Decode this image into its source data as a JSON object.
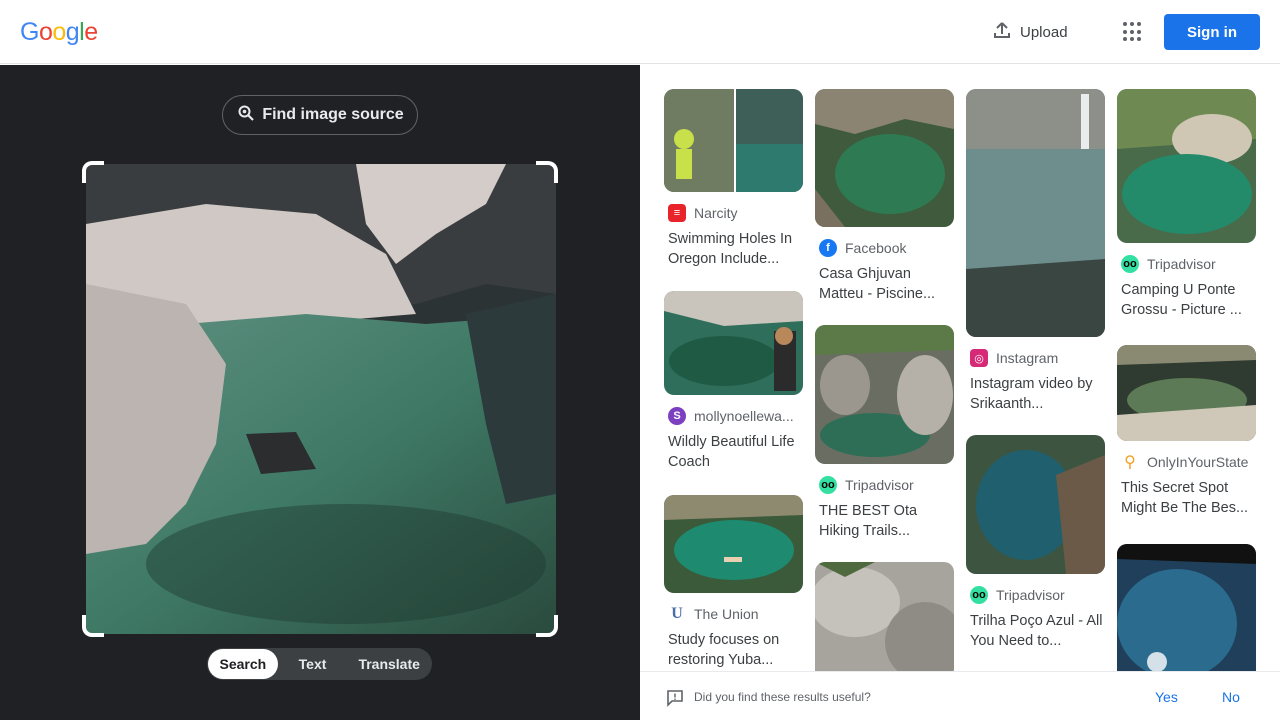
{
  "header": {
    "logo_letters": [
      {
        "ch": "G",
        "color": "#4285F4"
      },
      {
        "ch": "o",
        "color": "#EA4335"
      },
      {
        "ch": "o",
        "color": "#FBBC05"
      },
      {
        "ch": "g",
        "color": "#4285F4"
      },
      {
        "ch": "l",
        "color": "#34A853"
      },
      {
        "ch": "e",
        "color": "#EA4335"
      }
    ],
    "upload_label": "Upload",
    "apps_icon": "apps-grid-icon",
    "signin_label": "Sign in"
  },
  "left": {
    "find_source_label": "Find image source",
    "modes": [
      "Search",
      "Text",
      "Translate"
    ],
    "active_mode": "Search"
  },
  "results": [
    {
      "source": "Narcity",
      "icon": "narcity-icon",
      "icon_color": "#e8232a",
      "title": "Swimming Holes In Oregon Include..."
    },
    {
      "source": "Facebook",
      "icon": "facebook-icon",
      "icon_color": "#1877f2",
      "title": "Casa Ghjuvan Matteu - Piscine..."
    },
    {
      "source": "Instagram",
      "icon": "instagram-icon",
      "icon_color": "#d62976",
      "title": "Instagram video by Srikaanth..."
    },
    {
      "source": "Tripadvisor",
      "icon": "tripadvisor-icon",
      "icon_color": "#34e0a1",
      "title": "Camping U Ponte Grossu - Picture ..."
    },
    {
      "source": "mollynoellewa...",
      "icon": "molly-icon",
      "icon_color": "#7b3fbf",
      "title": "Wildly Beautiful Life Coach"
    },
    {
      "source": "Tripadvisor",
      "icon": "tripadvisor-icon",
      "icon_color": "#34e0a1",
      "title": "THE BEST Ota Hiking Trails..."
    },
    {
      "source": "Tripadvisor",
      "icon": "tripadvisor-icon",
      "icon_color": "#34e0a1",
      "title": "Trilha Poço Azul - All You Need to..."
    },
    {
      "source": "OnlyInYourState",
      "icon": "location-pin-icon",
      "icon_color": "#f0a020",
      "title": "This Secret Spot Might Be The Bes..."
    },
    {
      "source": "The Union",
      "icon": "the-union-icon",
      "icon_color": "#4a6fa5",
      "title": "Study focuses on restoring Yuba..."
    }
  ],
  "feedback": {
    "question": "Did you find these results useful?",
    "yes": "Yes",
    "no": "No"
  }
}
